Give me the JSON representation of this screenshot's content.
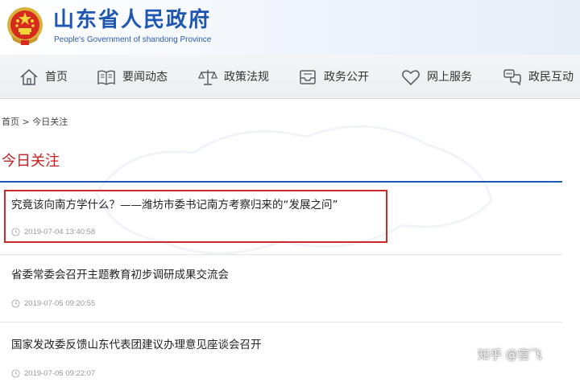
{
  "header": {
    "title": "山东省人民政府",
    "subtitle": "People's Government of shandong Province",
    "emblem_icon": "national-emblem-icon"
  },
  "nav": {
    "items": [
      {
        "label": "首页",
        "icon": "home-icon"
      },
      {
        "label": "要闻动态",
        "icon": "book-icon"
      },
      {
        "label": "政策法规",
        "icon": "scales-icon"
      },
      {
        "label": "政务公开",
        "icon": "inbox-icon"
      },
      {
        "label": "网上服务",
        "icon": "heart-icon"
      },
      {
        "label": "政民互动",
        "icon": "chat-icon"
      }
    ]
  },
  "breadcrumb": {
    "home": "首页",
    "separator": " > ",
    "current": "今日关注"
  },
  "section": {
    "title": "今日关注"
  },
  "articles": [
    {
      "title": "究竟该向南方学什么？——潍坊市委书记南方考察归来的“发展之问”",
      "time": "2019-07-04 13:40:58"
    },
    {
      "title": "省委常委会召开主题教育初步调研成果交流会",
      "time": "2019-07-05 09:20:55"
    },
    {
      "title": "国家发改委反馈山东代表团建议办理意见座谈会召开",
      "time": "2019-07-05 09:22:07"
    }
  ],
  "watermark": "知乎 @宫飞",
  "colors": {
    "brand_blue": "#1e56b0",
    "accent_red": "#c81e1e",
    "highlight_red": "#cc2a2a",
    "time_gray": "#999999"
  }
}
